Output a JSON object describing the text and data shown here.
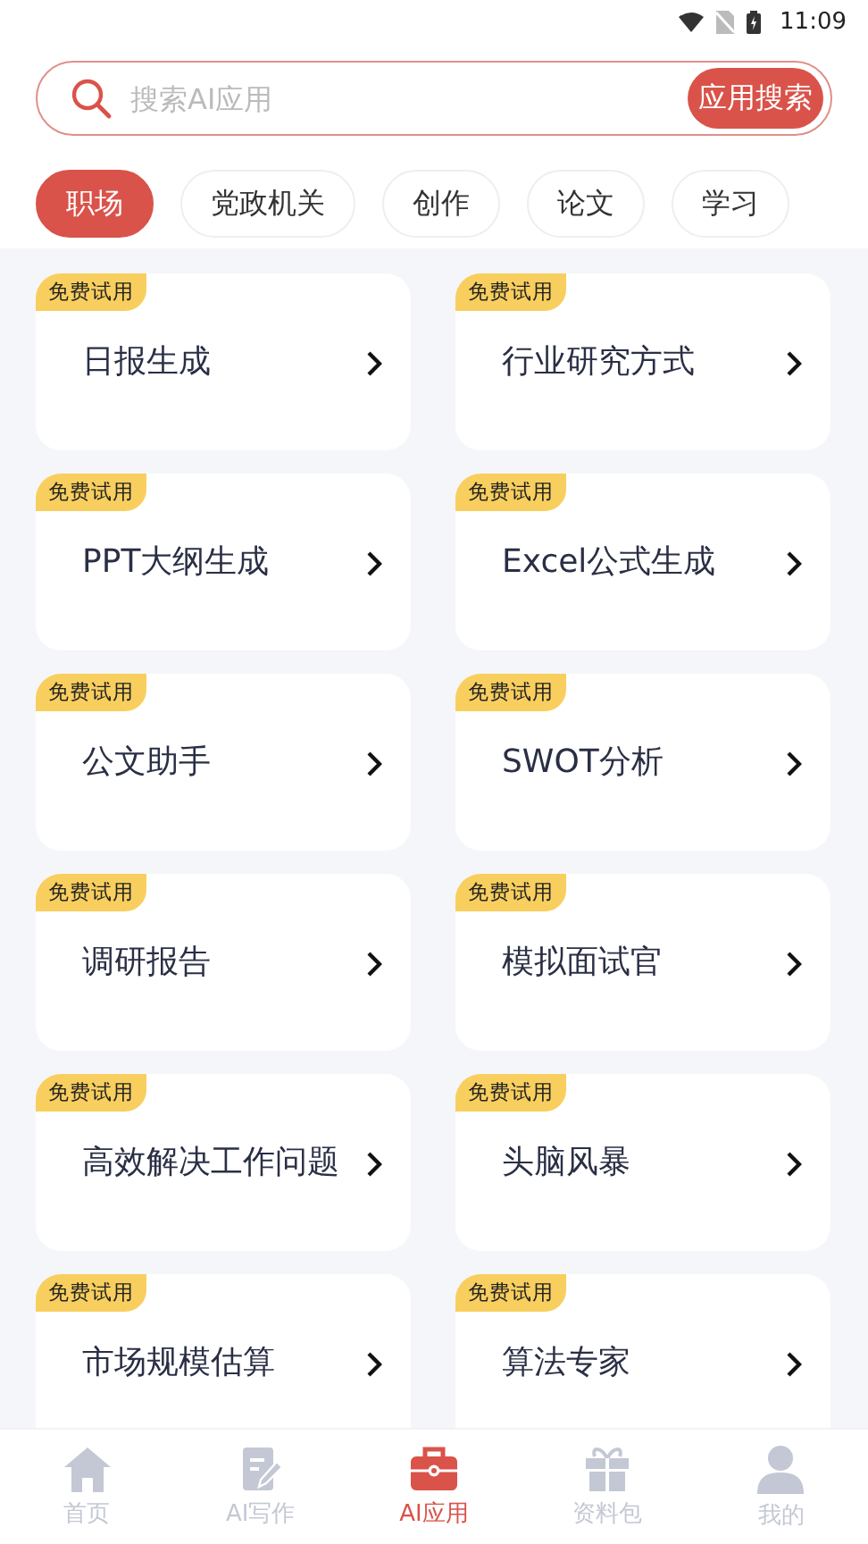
{
  "status_bar": {
    "time": "11:09"
  },
  "search": {
    "placeholder": "搜索AI应用",
    "button": "应用搜索"
  },
  "categories": [
    {
      "label": "职场",
      "selected": true
    },
    {
      "label": "党政机关",
      "selected": false
    },
    {
      "label": "创作",
      "selected": false
    },
    {
      "label": "论文",
      "selected": false
    },
    {
      "label": "学习",
      "selected": false
    }
  ],
  "apps": [
    {
      "badge": "免费试用",
      "title": "日报生成"
    },
    {
      "badge": "免费试用",
      "title": "行业研究方式"
    },
    {
      "badge": "免费试用",
      "title": "PPT大纲生成"
    },
    {
      "badge": "免费试用",
      "title": "Excel公式生成"
    },
    {
      "badge": "免费试用",
      "title": "公文助手"
    },
    {
      "badge": "免费试用",
      "title": "SWOT分析"
    },
    {
      "badge": "免费试用",
      "title": "调研报告"
    },
    {
      "badge": "免费试用",
      "title": "模拟面试官"
    },
    {
      "badge": "免费试用",
      "title": "高效解决工作问题"
    },
    {
      "badge": "免费试用",
      "title": "头脑风暴"
    },
    {
      "badge": "免费试用",
      "title": "市场规模估算"
    },
    {
      "badge": "免费试用",
      "title": "算法专家"
    }
  ],
  "nav": [
    {
      "kind": "home",
      "label": "首页",
      "selected": false
    },
    {
      "kind": "write",
      "label": "AI写作",
      "selected": false
    },
    {
      "kind": "apps",
      "label": "AI应用",
      "selected": true
    },
    {
      "kind": "gift",
      "label": "资料包",
      "selected": false
    },
    {
      "kind": "user",
      "label": "我的",
      "selected": false
    }
  ]
}
